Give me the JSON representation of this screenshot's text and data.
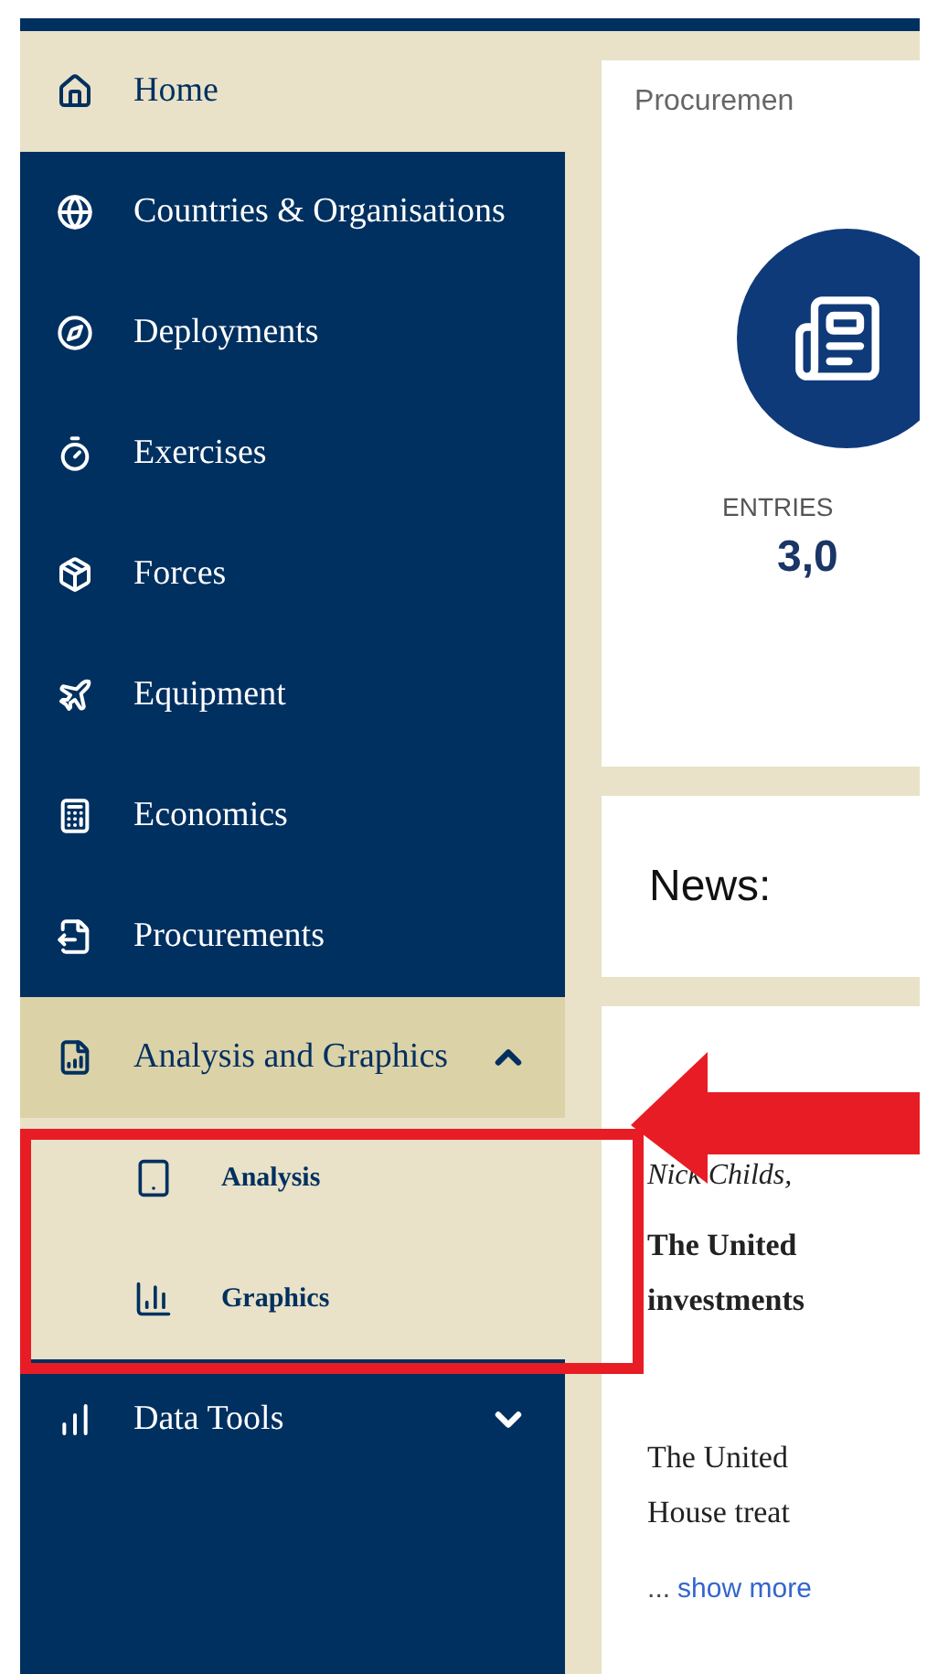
{
  "nav": [
    {
      "label": "Home",
      "selected": true,
      "expanded": false,
      "kind": "link"
    },
    {
      "label": "Countries & Organisations",
      "selected": false,
      "expanded": false,
      "kind": "link"
    },
    {
      "label": "Deployments",
      "selected": false,
      "expanded": false,
      "kind": "link"
    },
    {
      "label": "Exercises",
      "selected": false,
      "expanded": false,
      "kind": "link"
    },
    {
      "label": "Forces",
      "selected": false,
      "expanded": false,
      "kind": "link"
    },
    {
      "label": "Equipment",
      "selected": false,
      "expanded": false,
      "kind": "link"
    },
    {
      "label": "Economics",
      "selected": false,
      "expanded": false,
      "kind": "link"
    },
    {
      "label": "Procurements",
      "selected": false,
      "expanded": false,
      "kind": "link"
    },
    {
      "label": "Analysis and Graphics",
      "selected": false,
      "expanded": true,
      "kind": "group",
      "children": [
        {
          "label": "Analysis"
        },
        {
          "label": "Graphics"
        }
      ]
    },
    {
      "label": "Data Tools",
      "selected": false,
      "expanded": false,
      "kind": "group"
    }
  ],
  "stats_card": {
    "title": "Procuremen",
    "caption": "ENTRIES",
    "count": "3,0"
  },
  "news": {
    "heading": "News:"
  },
  "article": {
    "author": "Nick Childs,",
    "lead": [
      "The United",
      "investments"
    ],
    "body": [
      "The United",
      "House treat"
    ],
    "ellipsis": "...",
    "more_link": "show more"
  }
}
